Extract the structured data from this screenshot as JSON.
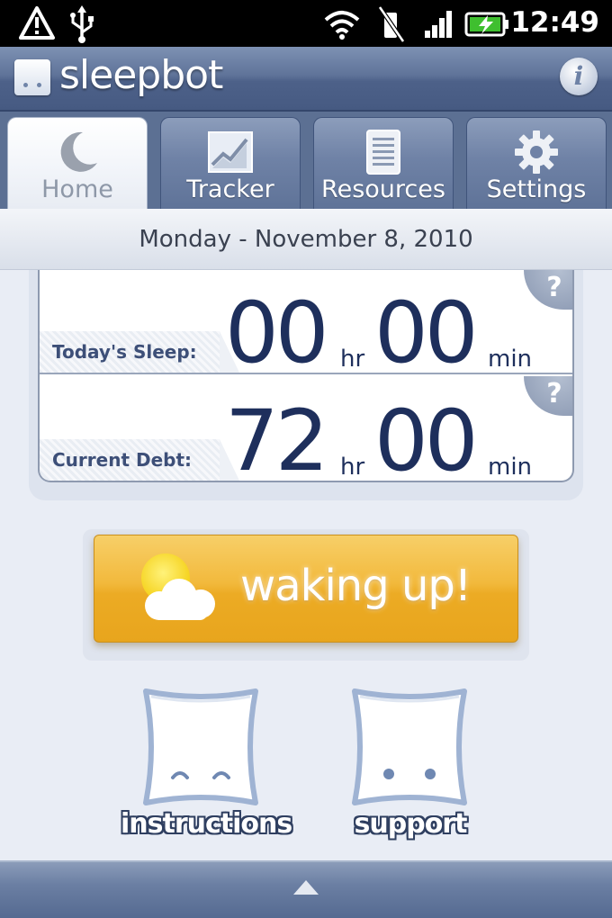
{
  "status_bar": {
    "time": "12:49",
    "icons": [
      "alert-icon",
      "usb-icon",
      "wifi-icon",
      "vibrate-icon",
      "signal-icon",
      "battery-charging-icon"
    ]
  },
  "header": {
    "app_name": "sleepbot",
    "info_glyph": "i"
  },
  "tabs": [
    {
      "label": "Home",
      "icon": "moon-icon",
      "active": true
    },
    {
      "label": "Tracker",
      "icon": "chart-icon",
      "active": false
    },
    {
      "label": "Resources",
      "icon": "document-icon",
      "active": false
    },
    {
      "label": "Settings",
      "icon": "gear-icon",
      "active": false
    }
  ],
  "date": "Monday - November 8, 2010",
  "stats": {
    "today_sleep": {
      "label": "Today's Sleep:",
      "hours": "00",
      "hours_unit": "hr",
      "minutes": "00",
      "minutes_unit": "min",
      "help": "?"
    },
    "current_debt": {
      "label": "Current Debt:",
      "hours": "72",
      "hours_unit": "hr",
      "minutes": "00",
      "minutes_unit": "min",
      "help": "?"
    }
  },
  "wake_button": {
    "label": "waking up!",
    "icon": "sun-cloud-icon"
  },
  "pillows": [
    {
      "label": "instructions",
      "icon": "pillow-smile-icon"
    },
    {
      "label": "support",
      "icon": "pillow-dots-icon"
    }
  ],
  "colors": {
    "header_blue": "#5f7399",
    "number_navy": "#1e2f5c",
    "wake_orange": "#f2b93c"
  }
}
